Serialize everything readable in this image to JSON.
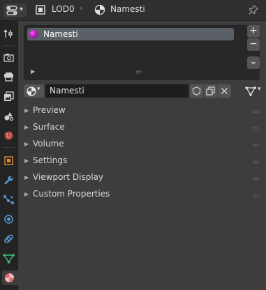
{
  "header": {
    "object_name": "LOD0",
    "material_name": "Namesti",
    "icons": {
      "editor_type": "properties-editor-icon",
      "object": "object-data-icon",
      "material": "material-icon",
      "pin": "pin-icon"
    }
  },
  "tabs": [
    {
      "name": "tool",
      "icon": "tool-settings-icon"
    },
    {
      "name": "render",
      "icon": "render-icon"
    },
    {
      "name": "output",
      "icon": "output-icon"
    },
    {
      "name": "view-layer",
      "icon": "view-layer-icon"
    },
    {
      "name": "scene",
      "icon": "scene-icon"
    },
    {
      "name": "world",
      "icon": "world-icon"
    },
    {
      "name": "object",
      "icon": "object-icon"
    },
    {
      "name": "modifiers",
      "icon": "wrench-icon"
    },
    {
      "name": "particles",
      "icon": "particles-icon"
    },
    {
      "name": "physics",
      "icon": "physics-icon"
    },
    {
      "name": "constraints",
      "icon": "constraints-icon"
    },
    {
      "name": "object-data",
      "icon": "mesh-data-icon"
    },
    {
      "name": "material",
      "icon": "material-icon",
      "active": true
    }
  ],
  "material_slots": {
    "items": [
      {
        "label": "Namesti",
        "selected": true
      }
    ],
    "add_label": "+",
    "remove_label": "−",
    "menu_label": "⌄"
  },
  "material_selector": {
    "name": "Namesti",
    "icons": [
      "fake-user-icon",
      "duplicate-icon",
      "unlink-icon",
      "node-tree-icon"
    ]
  },
  "panels": [
    {
      "label": "Preview"
    },
    {
      "label": "Surface"
    },
    {
      "label": "Volume"
    },
    {
      "label": "Settings"
    },
    {
      "label": "Viewport Display"
    },
    {
      "label": "Custom Properties"
    }
  ],
  "colors": {
    "background": "#3d3d3d",
    "header": "#303030",
    "tabs_bg": "#242424",
    "list_bg": "#282828",
    "selected_item": "#5b5f66",
    "button": "#545454",
    "field": "#1d1d1d",
    "material_accent": "#c31bc3"
  }
}
